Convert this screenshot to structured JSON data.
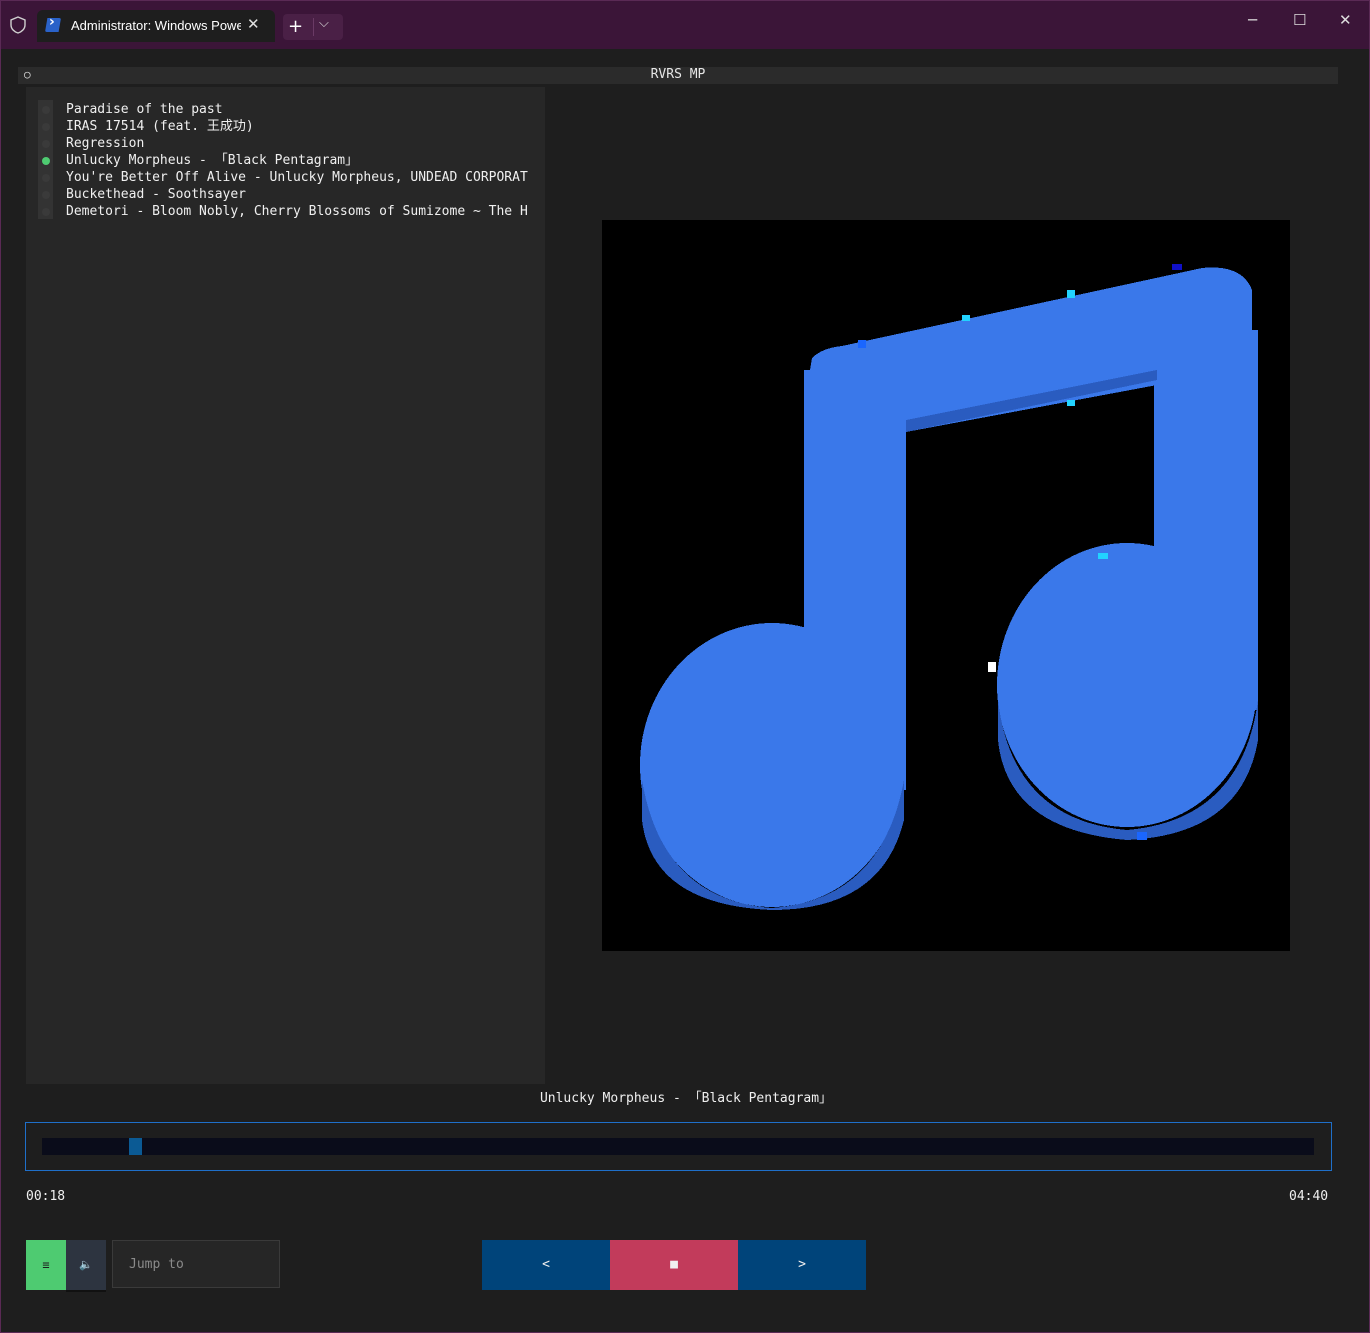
{
  "window": {
    "tab_title": "Administrator: Windows Powe",
    "tab_close": "✕",
    "new_tab": "+",
    "tab_menu": "⌵",
    "minimize": "─",
    "maximize": "☐",
    "close": "✕",
    "accent_color": "#3b1538"
  },
  "app": {
    "title": "RVRS MP",
    "header_marker": "○"
  },
  "playlist": {
    "items": [
      {
        "label": "Paradise of the past",
        "active": false
      },
      {
        "label": "IRAS 17514 (feat. 王成功)",
        "active": false
      },
      {
        "label": "Regression",
        "active": false
      },
      {
        "label": "Unlucky Morpheus - 「Black Pentagram」",
        "active": true
      },
      {
        "label": "You're Better Off Alive - Unlucky Morpheus, UNDEAD CORPORAT",
        "active": false
      },
      {
        "label": "Buckethead - Soothsayer",
        "active": false
      },
      {
        "label": "Demetori - Bloom Nobly, Cherry Blossoms of Sumizome ~ The H",
        "active": false
      }
    ],
    "active_color": "#4ecb71"
  },
  "album_art": {
    "icon": "music-note-icon",
    "color": "#3a78ea"
  },
  "now_playing": "Unlucky Morpheus - 「Black Pentagram」",
  "progress": {
    "elapsed": "00:18",
    "total": "04:40",
    "fraction": 0.064
  },
  "controls": {
    "playlist_toggle": "≡",
    "volume": "🔈",
    "jump_placeholder": "Jump to",
    "prev": "<",
    "stop": "■",
    "next": ">",
    "prev_color": "#00447a",
    "stop_color": "#c23b5b",
    "next_color": "#00447a"
  }
}
